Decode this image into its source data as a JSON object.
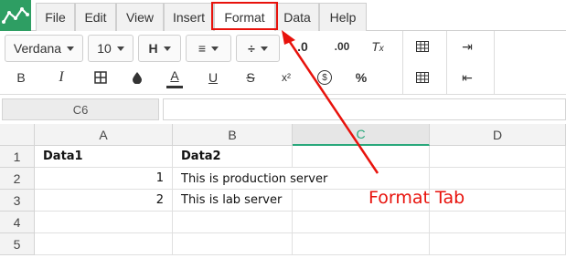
{
  "menu": {
    "tabs": [
      {
        "label": "File"
      },
      {
        "label": "Edit"
      },
      {
        "label": "View"
      },
      {
        "label": "Insert"
      },
      {
        "label": "Format"
      },
      {
        "label": "Data"
      },
      {
        "label": "Help"
      }
    ],
    "active_tab": "Format"
  },
  "toolbar": {
    "font_family": "Verdana",
    "font_size": "10",
    "icons": {
      "bold": "B",
      "italic": "I",
      "underline": "U",
      "strike": "S",
      "superscript": "x²",
      "font_color": "A",
      "currency": "$",
      "percent": "%",
      "decimal_dec": ".0",
      "decimal_inc": ".00"
    }
  },
  "formula_bar": {
    "cell_ref": "C6",
    "value": ""
  },
  "grid": {
    "columns": [
      "A",
      "B",
      "C",
      "D"
    ],
    "selected_column": "C",
    "rows": [
      {
        "num": "1",
        "a": "Data1",
        "b": "Data2"
      },
      {
        "num": "2",
        "a": "1",
        "b": "This is production server"
      },
      {
        "num": "3",
        "a": "2",
        "b": "This is lab server"
      },
      {
        "num": "4",
        "a": "",
        "b": ""
      },
      {
        "num": "5",
        "a": "",
        "b": ""
      }
    ]
  },
  "annotation": {
    "text": "Format Tab",
    "color": "#e8120c"
  },
  "colors": {
    "brand": "#2e9e63",
    "selection": "#2aa87c",
    "annotation": "#e8120c"
  }
}
